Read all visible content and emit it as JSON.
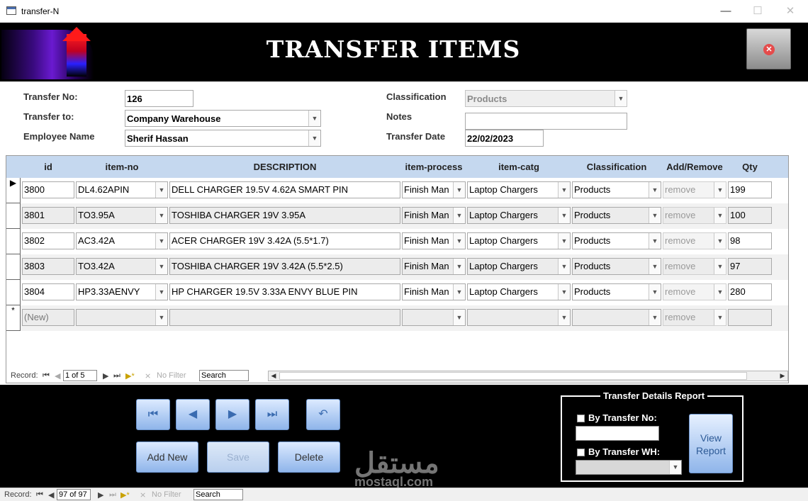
{
  "window": {
    "title": "transfer-N"
  },
  "header": {
    "title": "TRANSFER ITEMS"
  },
  "form": {
    "transfer_no_label": "Transfer No:",
    "transfer_no": "126",
    "transfer_to_label": "Transfer to:",
    "transfer_to": "Company Warehouse",
    "employee_label": "Employee Name",
    "employee": "Sherif Hassan",
    "classification_label": "Classification",
    "classification": "Products",
    "notes_label": "Notes",
    "notes": "",
    "date_label": "Transfer Date",
    "date": "22/02/2023"
  },
  "grid": {
    "headers": [
      "id",
      "item-no",
      "DESCRIPTION",
      "item-process",
      "item-catg",
      "Classification",
      "Add/Remove",
      "Qty"
    ],
    "rows": [
      {
        "id": "3800",
        "item_no": "DL4.62APIN",
        "description": "DELL CHARGER 19.5V 4.62A SMART PIN",
        "process": "Finish Man",
        "catg": "Laptop Chargers",
        "classification": "Products",
        "add_remove": "remove",
        "qty": "199"
      },
      {
        "id": "3801",
        "item_no": "TO3.95A",
        "description": "TOSHIBA CHARGER 19V 3.95A",
        "process": "Finish Man",
        "catg": "Laptop Chargers",
        "classification": "Products",
        "add_remove": "remove",
        "qty": "100"
      },
      {
        "id": "3802",
        "item_no": "AC3.42A",
        "description": "ACER CHARGER 19V 3.42A (5.5*1.7)",
        "process": "Finish Man",
        "catg": "Laptop Chargers",
        "classification": "Products",
        "add_remove": "remove",
        "qty": "98"
      },
      {
        "id": "3803",
        "item_no": "TO3.42A",
        "description": "TOSHIBA CHARGER 19V 3.42A (5.5*2.5)",
        "process": "Finish Man",
        "catg": "Laptop Chargers",
        "classification": "Products",
        "add_remove": "remove",
        "qty": "97"
      },
      {
        "id": "3804",
        "item_no": "HP3.33AENVY",
        "description": "HP CHARGER 19.5V 3.33A ENVY BLUE PIN",
        "process": "Finish Man",
        "catg": "Laptop Chargers",
        "classification": "Products",
        "add_remove": "remove",
        "qty": "280"
      }
    ],
    "new_row": {
      "id": "(New)",
      "add_remove": "remove"
    },
    "new_row_marker": "*"
  },
  "subform_nav": {
    "record_label": "Record:",
    "position": "1 of 5",
    "no_filter": "No Filter",
    "search": "Search"
  },
  "buttons": {
    "add_new": "Add New",
    "save": "Save",
    "delete": "Delete"
  },
  "report": {
    "title": "Transfer Details Report",
    "by_transfer_no": "By Transfer No:",
    "by_transfer_wh": "By Transfer WH:",
    "view_report": "View Report"
  },
  "watermark": {
    "main": "مستقل",
    "sub": "mostaql.com"
  },
  "main_nav": {
    "record_label": "Record:",
    "position": "97 of 97",
    "no_filter": "No Filter",
    "search": "Search"
  }
}
